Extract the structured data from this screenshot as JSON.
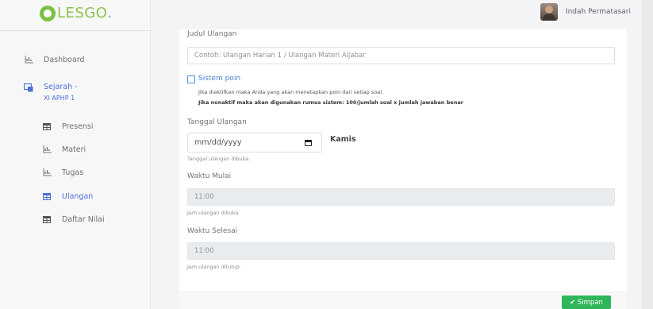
{
  "brand": {
    "logo_text": "LESGO",
    "logo_dot": "."
  },
  "user": {
    "name": "Indah Permatasari"
  },
  "sidebar": {
    "items": [
      {
        "label": "Dashboard"
      },
      {
        "label": "Sejarah -",
        "sub": "XI APHP 1"
      },
      {
        "label": "Presensi"
      },
      {
        "label": "Materi"
      },
      {
        "label": "Tugas"
      },
      {
        "label": "Ulangan"
      },
      {
        "label": "Daftar Nilai"
      }
    ]
  },
  "form": {
    "judul": {
      "label": "Judul Ulangan",
      "placeholder": "Contoh: Ulangan Harian 1 / Ulangan Materi Aljabar"
    },
    "sistem_poin": {
      "label": "Sistem poin",
      "help1": "Jika diaktifkan maka Anda yang akan menetapkan poin dari setiap soal.",
      "help2": "Jika nonaktif maka akan digunakan rumus sistem: 100/jumlah soal x jumlah jawaban benar"
    },
    "tanggal": {
      "label": "Tanggal Ulangan",
      "placeholder": "mm/dd/yyyy",
      "day": "Kamis",
      "help": "Tanggal ulangan dibuka."
    },
    "mulai": {
      "label": "Waktu Mulai",
      "value": "11:00",
      "help": "Jam ulangan dibuka"
    },
    "selesai": {
      "label": "Waktu Selesai",
      "value": "11:00",
      "help": "Jam ulangan ditutup."
    }
  },
  "actions": {
    "save_label": "✔ Simpan"
  }
}
